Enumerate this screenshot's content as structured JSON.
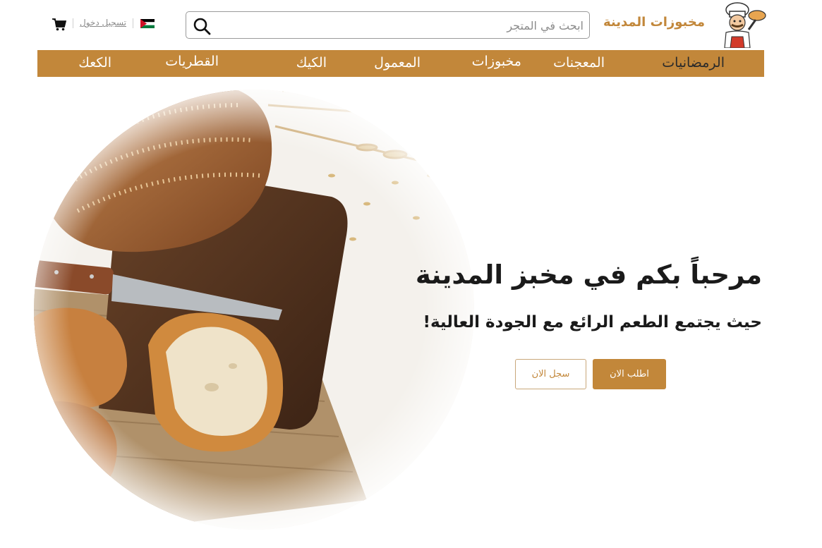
{
  "header": {
    "brand": "مخبوزات المدينة",
    "search_placeholder": "ابحث في المتجر",
    "login": "تسجيل دخول",
    "flag": "jordan-flag",
    "cart_icon": "cart-icon",
    "search_icon": "search-icon"
  },
  "nav": {
    "items": [
      {
        "label": "الرمضانيات"
      },
      {
        "label": "المعجنات"
      },
      {
        "label": "مخبوزات"
      },
      {
        "label": "المعمول"
      },
      {
        "label": "الكيك"
      },
      {
        "label": "القطريات"
      },
      {
        "label": "الكعك"
      }
    ]
  },
  "hero": {
    "title": "مرحباً بكم في مخبز المدينة",
    "subtitle": "حيث يجتمع الطعم الرائع مع الجودة العالية!",
    "order_button": "اطلب الان",
    "register_button": "سجل الان"
  },
  "colors": {
    "accent": "#c2873a",
    "text": "#1a1a1a"
  }
}
